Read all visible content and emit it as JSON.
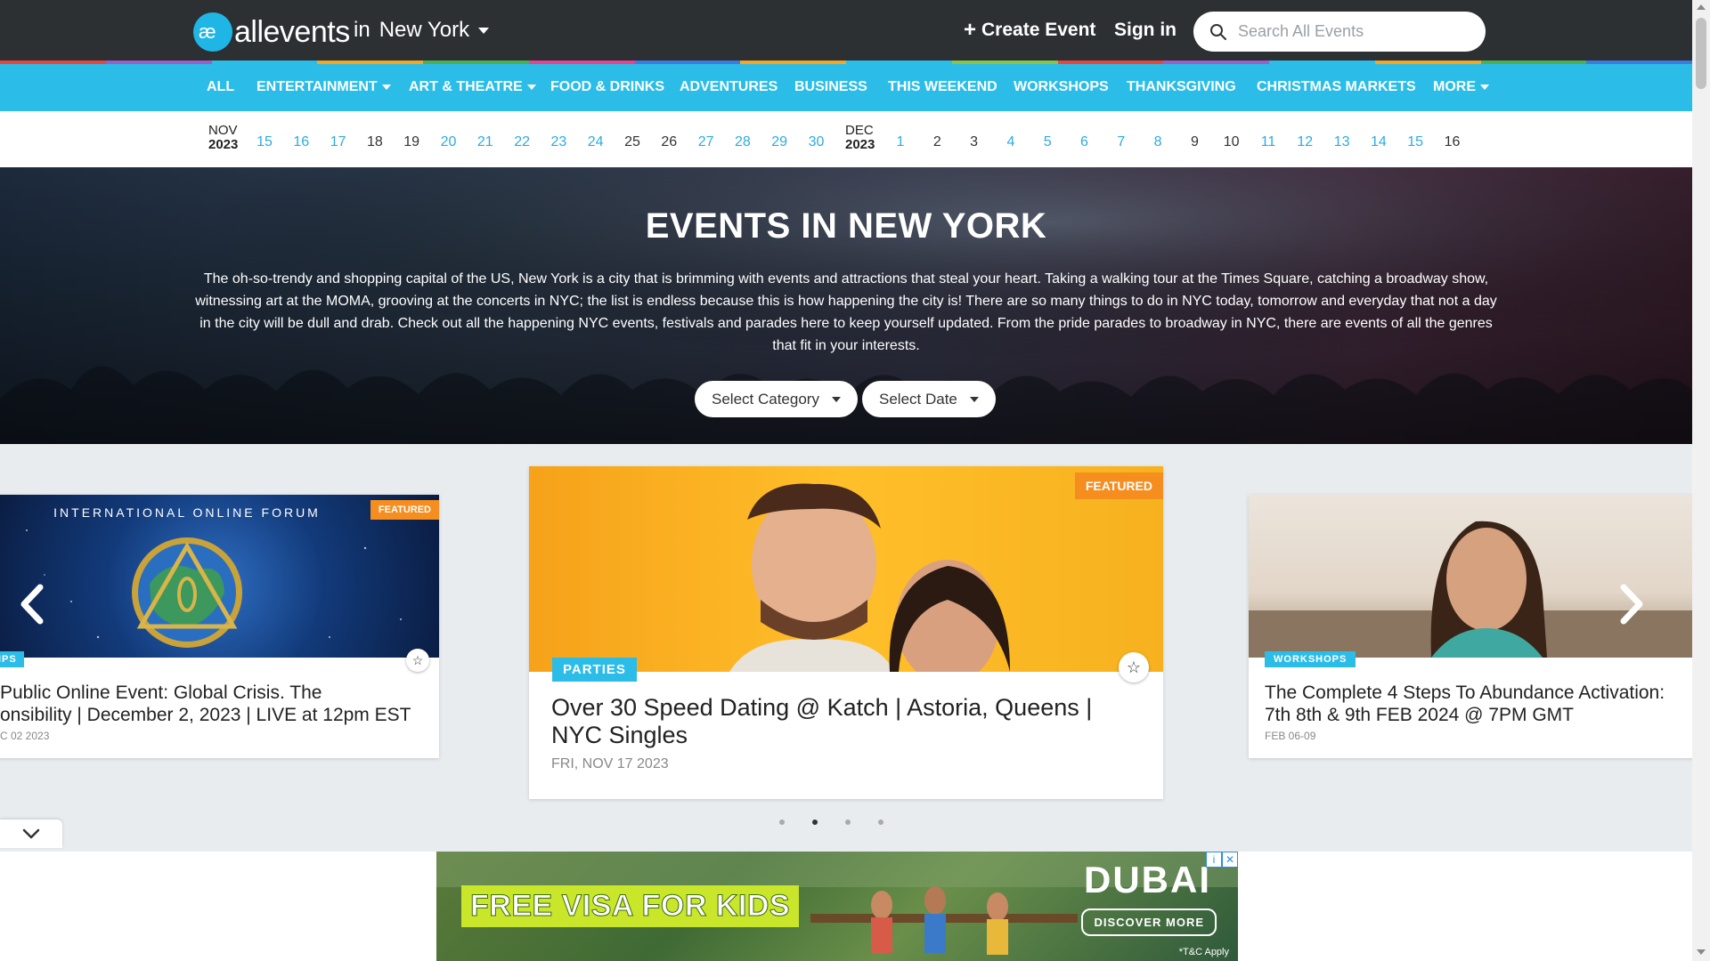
{
  "header": {
    "logo_text": "allevents",
    "city_prefix": "in",
    "city": "New York",
    "create_event": "Create Event",
    "sign_in": "Sign in",
    "search_placeholder": "Search All Events"
  },
  "category_nav": [
    {
      "label": "ALL",
      "dropdown": false
    },
    {
      "label": "ENTERTAINMENT",
      "dropdown": true
    },
    {
      "label": "ART & THEATRE",
      "dropdown": true
    },
    {
      "label": "FOOD & DRINKS",
      "dropdown": false
    },
    {
      "label": "ADVENTURES",
      "dropdown": false
    },
    {
      "label": "BUSINESS",
      "dropdown": false
    },
    {
      "label": "THIS WEEKEND",
      "dropdown": false
    },
    {
      "label": "WORKSHOPS",
      "dropdown": false
    },
    {
      "label": "THANKSGIVING",
      "dropdown": false
    },
    {
      "label": "CHRISTMAS MARKETS",
      "dropdown": false
    },
    {
      "label": "MORE",
      "dropdown": true
    }
  ],
  "date_strip": {
    "months": [
      {
        "month": "NOV",
        "year": "2023"
      },
      {
        "month": "DEC",
        "year": "2023"
      }
    ],
    "nov_days": [
      "15",
      "16",
      "17",
      "18",
      "19",
      "20",
      "21",
      "22",
      "23",
      "24",
      "25",
      "26",
      "27",
      "28",
      "29",
      "30"
    ],
    "dec_days": [
      "1",
      "2",
      "3",
      "4",
      "5",
      "6",
      "7",
      "8",
      "9",
      "10",
      "11",
      "12",
      "13",
      "14",
      "15",
      "16"
    ],
    "weekend_days_nov": [
      "18",
      "19",
      "25",
      "26"
    ],
    "weekend_days_dec": [
      "2",
      "3",
      "9",
      "10",
      "16"
    ]
  },
  "hero": {
    "title": "EVENTS IN NEW YORK",
    "description": "The oh-so-trendy and shopping capital of the US, New York is a city that is brimming with events and attractions that steal your heart. Taking a walking tour at the Times Square, catching a broadway show, witnessing art at the MOMA, grooving at the concerts in NYC; the list is endless because this is how happening the city is! There are so many things to do in NYC today, tomorrow and everyday that not a day in the city will be dull and drab. Check out all the happening NYC events, festivals and parades here to keep yourself updated. From the pride parades to broadway in NYC, there are events of all the genres that fit in your interests.",
    "select_category": "Select Category",
    "select_date": "Select Date"
  },
  "carousel": {
    "cards": [
      {
        "featured": "FEATURED",
        "image_caption": "INTERNATIONAL ONLINE FORUM",
        "tag": "IPS",
        "title_line1": "Public Online Event: Global Crisis. The",
        "title_line2": "onsibility | December 2, 2023 | LIVE at 12pm EST",
        "date": "C 02 2023"
      },
      {
        "featured": "FEATURED",
        "tag": "PARTIES",
        "title_line1": "Over 30 Speed Dating @ Katch | Astoria, Queens |",
        "title_line2": "NYC Singles",
        "date": "FRI, NOV 17 2023"
      },
      {
        "tag": "WORKSHOPS",
        "title_line1": "The Complete 4 Steps To Abundance Activation:",
        "title_line2": "7th 8th & 9th FEB 2024 @ 7PM GMT",
        "date": "FEB 06-09"
      }
    ],
    "active_dot": 2,
    "dot_count": 4
  },
  "ad": {
    "headline": "FREE VISA FOR KIDS",
    "brand": "DUBAI",
    "cta": "DISCOVER MORE",
    "terms": "*T&C Apply"
  },
  "colors": {
    "topbar": "#2c3033",
    "nav": "#2bbde8",
    "accent_blue": "#2bace2",
    "featured_orange": "#f58d1f",
    "strip": [
      "#e8453c",
      "#9c5ec9",
      "#2bbde8",
      "#f5a623",
      "#4caf50",
      "#e84393",
      "#3d7be0",
      "#f5a623",
      "#2bbde8",
      "#8bc34a",
      "#e8453c",
      "#9c5ec9",
      "#2bbde8",
      "#f5a623",
      "#4caf50",
      "#3d7be0"
    ]
  },
  "icons": {
    "search": "search-icon",
    "plus": "plus-icon",
    "star": "star-outline-icon",
    "chevron_left": "chevron-left-icon",
    "chevron_right": "chevron-right-icon",
    "chevron_down": "chevron-down-icon"
  }
}
